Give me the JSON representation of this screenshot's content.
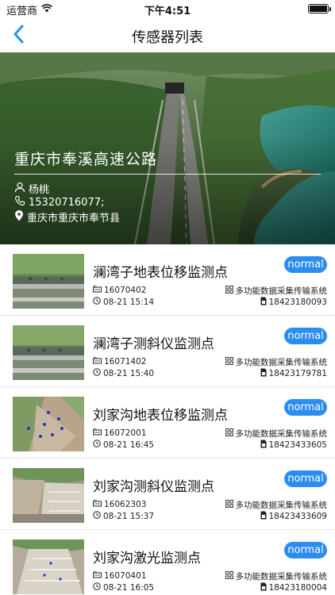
{
  "status_bar": {
    "carrier": "运营商",
    "time": "下午4:51",
    "wifi_icon": "wifi-icon",
    "battery_icon": "battery-icon"
  },
  "nav": {
    "title": "传感器列表",
    "back_icon": "chevron-left-icon"
  },
  "project": {
    "name": "重庆市奉溪高速公路",
    "contact_name": "杨桃",
    "phone": "15320716077;",
    "location": "重庆市重庆市奉节县"
  },
  "colors": {
    "accent": "#2b8df0",
    "badge_bg": "#2b8df0",
    "nav_back": "#2b8df0"
  },
  "sensors": [
    {
      "name": "澜湾子地表位移监测点",
      "status": "normal",
      "code": "16070402",
      "time": "08-21 15:14",
      "system": "多功能数据采集传输系统",
      "sim": "18423180093"
    },
    {
      "name": "澜湾子测斜仪监测点",
      "status": "normal",
      "code": "16071402",
      "time": "08-21 15:40",
      "system": "多功能数据采集传输系统",
      "sim": "18423179781"
    },
    {
      "name": "刘家沟地表位移监测点",
      "status": "normal",
      "code": "16072001",
      "time": "08-21 16:45",
      "system": "多功能数据采集传输系统",
      "sim": "18423433605"
    },
    {
      "name": "刘家沟测斜仪监测点",
      "status": "normal",
      "code": "16062303",
      "time": "08-21 15:37",
      "system": "多功能数据采集传输系统",
      "sim": "18423433609"
    },
    {
      "name": "刘家沟激光监测点",
      "status": "normal",
      "code": "16070401",
      "time": "08-21 16:05",
      "system": "多功能数据采集传输系统",
      "sim": "18423180004"
    }
  ]
}
